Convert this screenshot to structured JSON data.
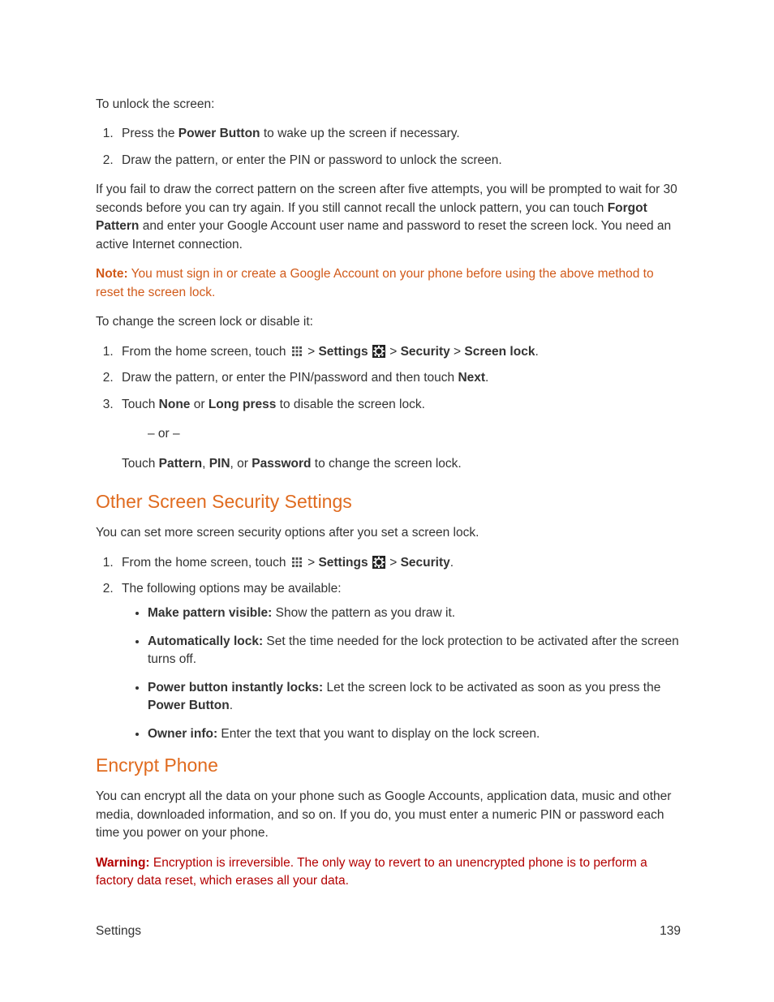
{
  "intro": "To unlock the screen:",
  "unlock_steps": [
    {
      "pre": "Press the ",
      "bold": "Power Button",
      "post": " to wake up the screen if necessary."
    },
    {
      "plain": "Draw the pattern, or enter the PIN or password to unlock the screen."
    }
  ],
  "fail_para_pre": "If you fail to draw the correct pattern on the screen after five attempts, you will be prompted to wait for 30 seconds before you can try again. If you still cannot recall the unlock pattern, you can touch ",
  "fail_para_bold": "Forgot Pattern",
  "fail_para_post": " and enter your Google Account user name and password to reset the screen lock. You need an active Internet connection.",
  "note_label": "Note:",
  "note_text": " You must sign in or create a Google Account on your phone before using the above method to reset the screen lock.",
  "change_intro": "To change the screen lock or disable it:",
  "change_step1_pre": "From the home screen, touch ",
  "change_step1_gt1": " > ",
  "change_step1_settings": "Settings",
  "change_step1_gt2": " > ",
  "change_step1_security": "Security",
  "change_step1_gt3": " > ",
  "change_step1_screenlock": "Screen lock",
  "change_step1_period": ".",
  "change_step2_pre": "Draw the pattern, or enter the PIN/password and then touch ",
  "change_step2_bold": "Next",
  "change_step2_post": ".",
  "change_step3_pre": "Touch ",
  "change_step3_b1": "None",
  "change_step3_mid": " or ",
  "change_step3_b2": "Long press",
  "change_step3_post": " to disable the screen lock.",
  "or_text": "– or –",
  "touch_alt_pre": "Touch ",
  "touch_alt_b1": "Pattern",
  "touch_alt_c1": ", ",
  "touch_alt_b2": "PIN",
  "touch_alt_c2": ", or ",
  "touch_alt_b3": "Password",
  "touch_alt_post": " to change the screen lock.",
  "h_other": "Other Screen Security Settings",
  "other_intro": "You can set more screen security options after you set a screen lock.",
  "other_step1_pre": "From the home screen, touch ",
  "other_step1_gt1": " > ",
  "other_step1_settings": "Settings",
  "other_step1_gt2": " > ",
  "other_step1_security": "Security",
  "other_step1_period": ".",
  "other_step2": "The following options may be available:",
  "opts": [
    {
      "b": "Make pattern visible:",
      "t": " Show the pattern as you draw it."
    },
    {
      "b": "Automatically lock:",
      "t": " Set the time needed for the lock protection to be activated after the screen turns off."
    },
    {
      "b": "Power button instantly locks:",
      "t_pre": " Let the screen lock to be activated as soon as you press the ",
      "t_bold": "Power Button",
      "t_post": "."
    },
    {
      "b": "Owner info:",
      "t": " Enter the text that you want to display on the lock screen."
    }
  ],
  "h_encrypt": "Encrypt Phone",
  "encrypt_intro": "You can encrypt all the data on your phone such as Google Accounts, application data, music and other media, downloaded information, and so on. If you do, you must enter a numeric PIN or password each time you power on your phone.",
  "warning_label": "Warning:",
  "warning_text": " Encryption is irreversible. The only way to revert to an unencrypted phone is to perform a factory data reset, which erases all your data.",
  "footer_left": "Settings",
  "footer_right": "139"
}
